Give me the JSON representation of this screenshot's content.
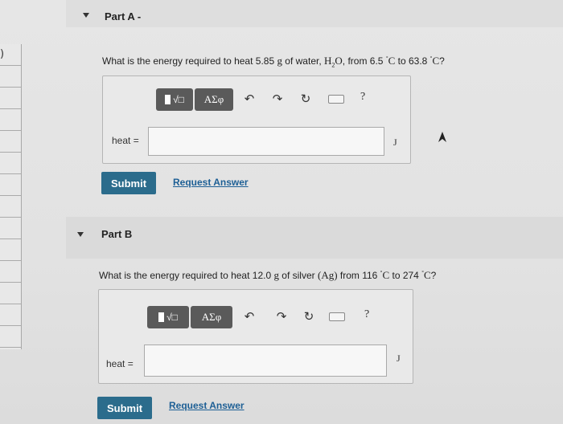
{
  "left_paren": ")",
  "partA": {
    "title": "Part A -",
    "question_pre": "What is the energy required to heat 5.85 ",
    "unit_g": "g",
    "of_water": " of water, ",
    "formula_main": "H",
    "formula_sub": "2",
    "formula_end": "O",
    "from_text": ", from 6.5 ",
    "deg1": "°",
    "C1": "C",
    "to_text": " to 63.8 ",
    "deg2": "°",
    "C2": "C",
    "qmark": "?",
    "heat_label": "heat =",
    "unit": "J",
    "submit": "Submit",
    "request": "Request Answer"
  },
  "partB": {
    "title": "Part B",
    "question_pre": "What is the energy required to heat 12.0 ",
    "unit_g": "g",
    "of_silver": " of silver ",
    "element": "(Ag)",
    "from_text": " from 116 ",
    "deg1": "°",
    "C1": "C",
    "to_text": " to 274 ",
    "deg2": "°",
    "C2": "C",
    "qmark": "?",
    "heat_label": "heat =",
    "unit": "J",
    "submit": "Submit",
    "request": "Request Answer"
  },
  "toolbar": {
    "templates_label": "√□",
    "greek_label": "ΑΣφ",
    "help_label": "?"
  }
}
